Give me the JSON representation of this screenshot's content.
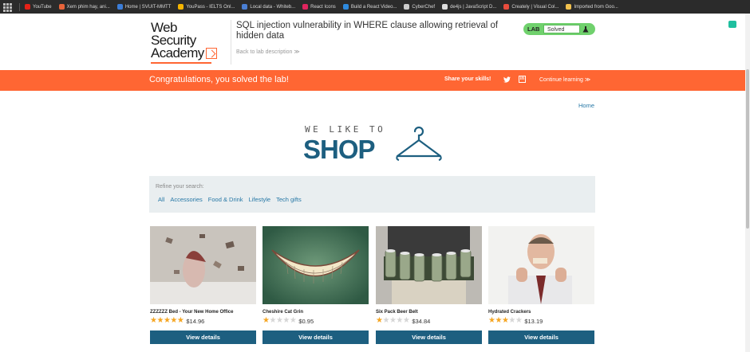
{
  "bookmarks": [
    {
      "label": "YouTube",
      "color": "#e62117"
    },
    {
      "label": "Xem phim hay, ani...",
      "color": "#e8643a"
    },
    {
      "label": "Home | SVUIT-MMTT",
      "color": "#3b7dd8"
    },
    {
      "label": "YouPass - IELTS Onl...",
      "color": "#f4b400"
    },
    {
      "label": "Local data - Whiteb...",
      "color": "#4a7fd4"
    },
    {
      "label": "React Icons",
      "color": "#e0245e"
    },
    {
      "label": "Build a React Video...",
      "color": "#2e8ade"
    },
    {
      "label": "CyberChef",
      "color": "#cccccc"
    },
    {
      "label": "de4js | JavaScript D...",
      "color": "#dddddd"
    },
    {
      "label": "Creately | Visual Col...",
      "color": "#e84c3d"
    },
    {
      "label": "Imported from Goo...",
      "color": "#f2c14e"
    }
  ],
  "header": {
    "logo_line1": "Web Security",
    "logo_line2": "Academy",
    "lab_title": "SQL injection vulnerability in WHERE clause allowing retrieval of hidden data",
    "back_link": "Back to lab description  ≫",
    "status_label": "LAB",
    "status_value": "Solved"
  },
  "banner": {
    "message": "Congratulations, you solved the lab!",
    "share": "Share your skills!",
    "continue": "Continue learning  ≫"
  },
  "nav": {
    "home": "Home"
  },
  "shop_logo": {
    "top": "WE LIKE TO",
    "main": "SHOP"
  },
  "filter": {
    "label": "Refine your search:",
    "categories": [
      "All",
      "Accessories",
      "Food & Drink",
      "Lifestyle",
      "Tech gifts"
    ]
  },
  "products": [
    {
      "name": "ZZZZZZ Bed - Your New Home Office",
      "rating": 5,
      "price": "$14.96",
      "button": "View details"
    },
    {
      "name": "Cheshire Cat Grin",
      "rating": 1,
      "price": "$0.95",
      "button": "View details"
    },
    {
      "name": "Six Pack Beer Belt",
      "rating": 1,
      "price": "$34.84",
      "button": "View details"
    },
    {
      "name": "Hydrated Crackers",
      "rating": 3,
      "price": "$13.19",
      "button": "View details"
    }
  ],
  "colors": {
    "accent_orange": "#ff6633",
    "brand_blue": "#1d5f80",
    "link_blue": "#2778a6",
    "lab_green": "#70d16d",
    "star": "#f5a623"
  }
}
